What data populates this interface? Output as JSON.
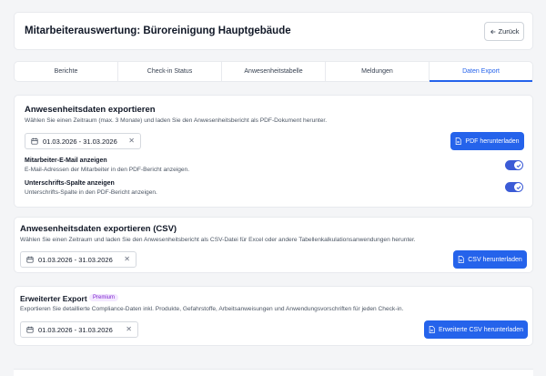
{
  "header": {
    "title": "Mitarbeiterauswertung: Büroreinigung Hauptgebäude",
    "back_label": "Zurück"
  },
  "tabs": [
    {
      "label": "Berichte"
    },
    {
      "label": "Check-in Status"
    },
    {
      "label": "Anwesenheitstabelle"
    },
    {
      "label": "Meldungen"
    },
    {
      "label": "Daten Export"
    }
  ],
  "active_tab": "Daten Export",
  "pdf_export": {
    "title": "Anwesenheitsdaten exportieren",
    "description": "Wählen Sie einen Zeitraum (max. 3 Monate) und laden Sie den Anwesenheitsbericht als PDF-Dokument herunter.",
    "date_range": "01.03.2026 - 31.03.2026",
    "button": "PDF herunterladen",
    "options": [
      {
        "title": "Mitarbeiter-E-Mail anzeigen",
        "description": "E-Mail-Adressen der Mitarbeiter in den PDF-Bericht anzeigen.",
        "enabled": true
      },
      {
        "title": "Unterschrifts-Spalte anzeigen",
        "description": "Unterschrifts-Spalte in den PDF-Bericht anzeigen.",
        "enabled": true
      }
    ]
  },
  "csv_export": {
    "title": "Anwesenheitsdaten exportieren (CSV)",
    "description": "Wählen Sie einen Zeitraum und laden Sie den Anwesenheitsbericht als CSV-Datei für Excel oder andere Tabellenkalkulationsanwendungen herunter.",
    "date_range": "01.03.2026 - 31.03.2026",
    "button": "CSV herunterladen"
  },
  "extended_export": {
    "title": "Erweiterter Export",
    "badge": "Premium",
    "description": "Exportieren Sie detaillierte Compliance-Daten inkl. Produkte, Gefahrstoffe, Arbeitsanweisungen und Anwendungsvorschriften für jeden Check-in.",
    "date_range": "01.03.2026 - 31.03.2026",
    "button": "Erweiterte CSV herunterladen"
  },
  "colors": {
    "accent": "#2563eb",
    "toggle_on": "#3b5bd6",
    "badge_text": "#7e22ce",
    "badge_bg": "#f3e8ff",
    "page_bg": "#f4f5f7"
  },
  "icons": {
    "back": "arrow-left-icon",
    "calendar": "calendar-icon",
    "clear": "close-icon",
    "file": "file-icon",
    "toggle": "check-icon"
  }
}
